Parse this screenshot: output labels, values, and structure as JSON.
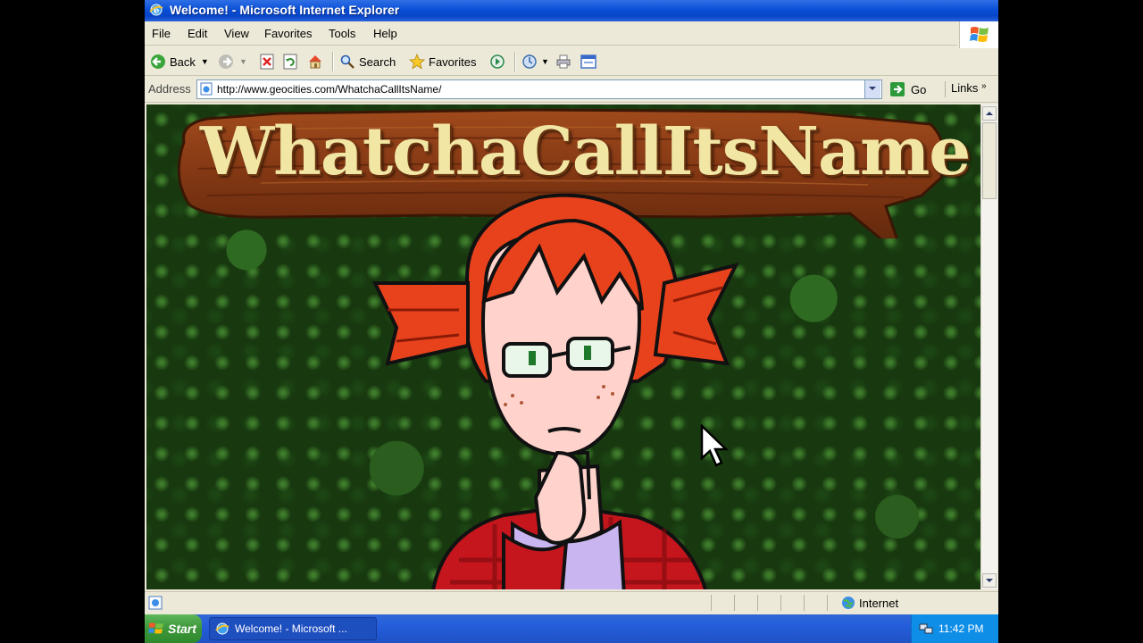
{
  "window": {
    "title": "Welcome! - Microsoft Internet Explorer"
  },
  "menu": {
    "items": [
      "File",
      "Edit",
      "View",
      "Favorites",
      "Tools",
      "Help"
    ]
  },
  "toolbar": {
    "back_label": "Back",
    "search_label": "Search",
    "favorites_label": "Favorites"
  },
  "address": {
    "label": "Address",
    "url": "http://www.geocities.com/WhatchaCallItsName/",
    "go_label": "Go",
    "links_label": "Links"
  },
  "page": {
    "banner_title": "WhatchaCallItsName"
  },
  "status": {
    "zone_label": "Internet"
  },
  "taskbar": {
    "start_label": "Start",
    "task_label": "Welcome! - Microsoft ...",
    "clock": "11:42 PM"
  },
  "colors": {
    "xp_blue": "#0a4fd6",
    "chrome": "#ece9d8",
    "foliage": "#18390f",
    "sign_wood": "#8a3f18",
    "sign_text": "#f2e6a4",
    "hair": "#e8421c",
    "skin": "#ffd3cc",
    "shirt": "#c9b6f0",
    "flannel": "#c4161c"
  }
}
